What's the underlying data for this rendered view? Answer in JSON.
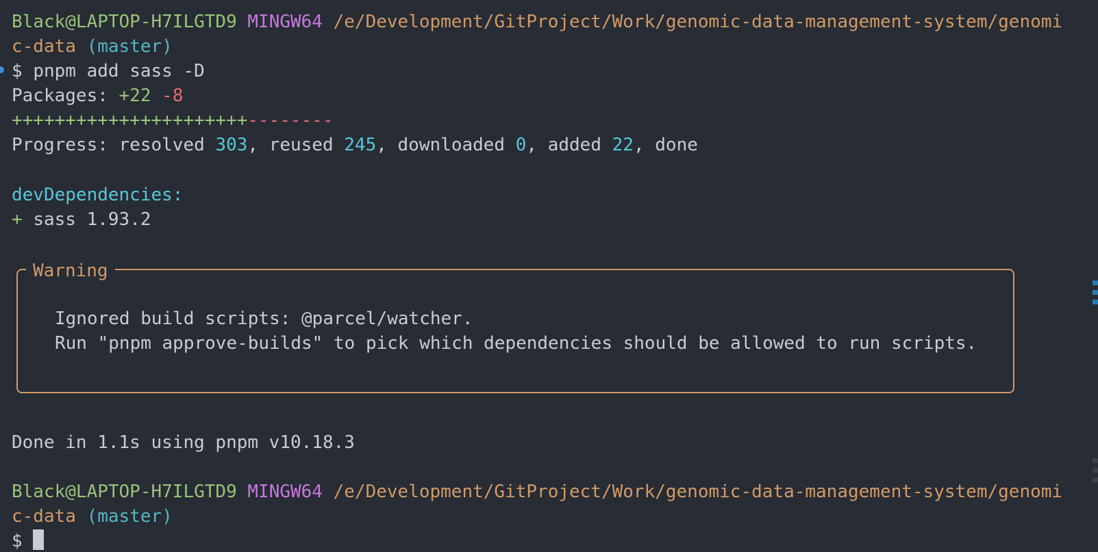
{
  "prompt1": {
    "user": "Black@LAPTOP-H7ILGTD9",
    "env": "MINGW64",
    "path_part1": "/e/Development/GitProject/Work/genomic-data-management-system/genomi",
    "path_part2": "c-data",
    "branch": "(master)"
  },
  "command": {
    "symbol": "$",
    "text": "pnpm add sass -D"
  },
  "packages": {
    "label": "Packages:",
    "added": "+22",
    "removed": "-8"
  },
  "progress_bar": {
    "plus": "++++++++++++++++++++++",
    "minus": "--------"
  },
  "progress": {
    "label": "Progress: resolved",
    "resolved": "303",
    "reused_label": ", reused",
    "reused": "245",
    "downloaded_label": ", downloaded",
    "downloaded": "0",
    "added_label": ", added",
    "added": "22",
    "done_label": ", done"
  },
  "dev_dependencies": {
    "header": "devDependencies:",
    "plus": "+",
    "item": "sass 1.93.2"
  },
  "warning": {
    "title": "Warning",
    "line1": "Ignored build scripts: @parcel/watcher.",
    "line2": "Run \"pnpm approve-builds\" to pick which dependencies should be allowed to run scripts."
  },
  "done": {
    "text": "Done in 1.1s using pnpm v10.18.3"
  },
  "prompt2": {
    "user": "Black@LAPTOP-H7ILGTD9",
    "env": "MINGW64",
    "path_part1": "/e/Development/GitProject/Work/genomic-data-management-system/genomi",
    "path_part2": "c-data",
    "branch": "(master)",
    "symbol": "$"
  },
  "colors": {
    "background": "#282c34",
    "user": "#98c379",
    "env": "#c678dd",
    "path": "#d19a66",
    "branch": "#56b6c2",
    "removed": "#e06c75",
    "warning": "#d19a66",
    "scroll_marker": "#1f7fb8"
  }
}
